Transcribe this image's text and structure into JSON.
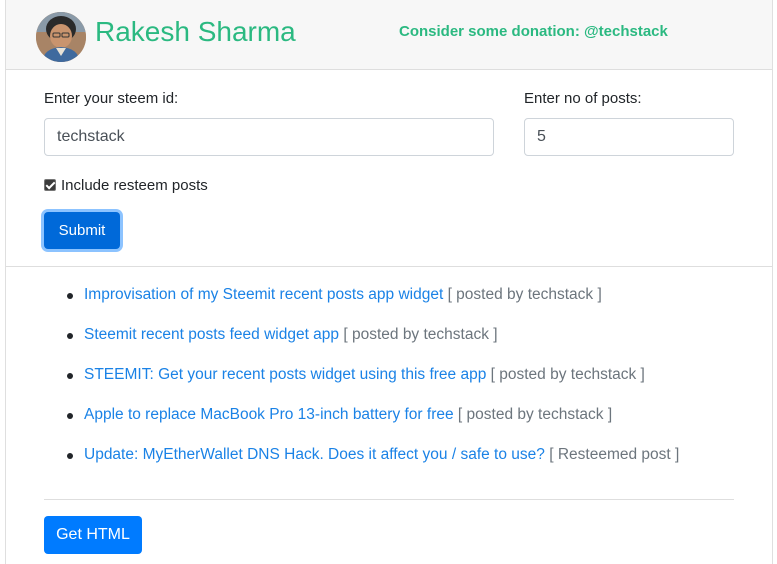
{
  "header": {
    "name": "Rakesh Sharma",
    "donation": "Consider some donation: @techstack",
    "avatar_icon": "user-avatar-icon"
  },
  "form": {
    "steem_id_label": "Enter your steem id:",
    "steem_id_value": "techstack",
    "steem_id_placeholder": "techstack",
    "posts_label": "Enter no of posts:",
    "posts_value": "5",
    "resteem_label": "Include resteem posts",
    "resteem_checked": true,
    "submit_label": "Submit"
  },
  "posts": [
    {
      "title": "Improvisation of my Steemit recent posts app widget",
      "meta": "[ posted by techstack ]"
    },
    {
      "title": "Steemit recent posts feed widget app",
      "meta": "[ posted by techstack ]"
    },
    {
      "title": "STEEMIT: Get your recent posts widget using this free app",
      "meta": "[ posted by techstack ]"
    },
    {
      "title": "Apple to replace MacBook Pro 13-inch battery for free",
      "meta": "[ posted by techstack ]"
    },
    {
      "title": "Update: MyEtherWallet DNS Hack. Does it affect you / safe to use?",
      "meta": "[ Resteemed post ]"
    }
  ],
  "get_html_label": "Get HTML",
  "colors": {
    "brand": "#2bb981",
    "primary": "#007bff",
    "link": "#1a82e6"
  }
}
